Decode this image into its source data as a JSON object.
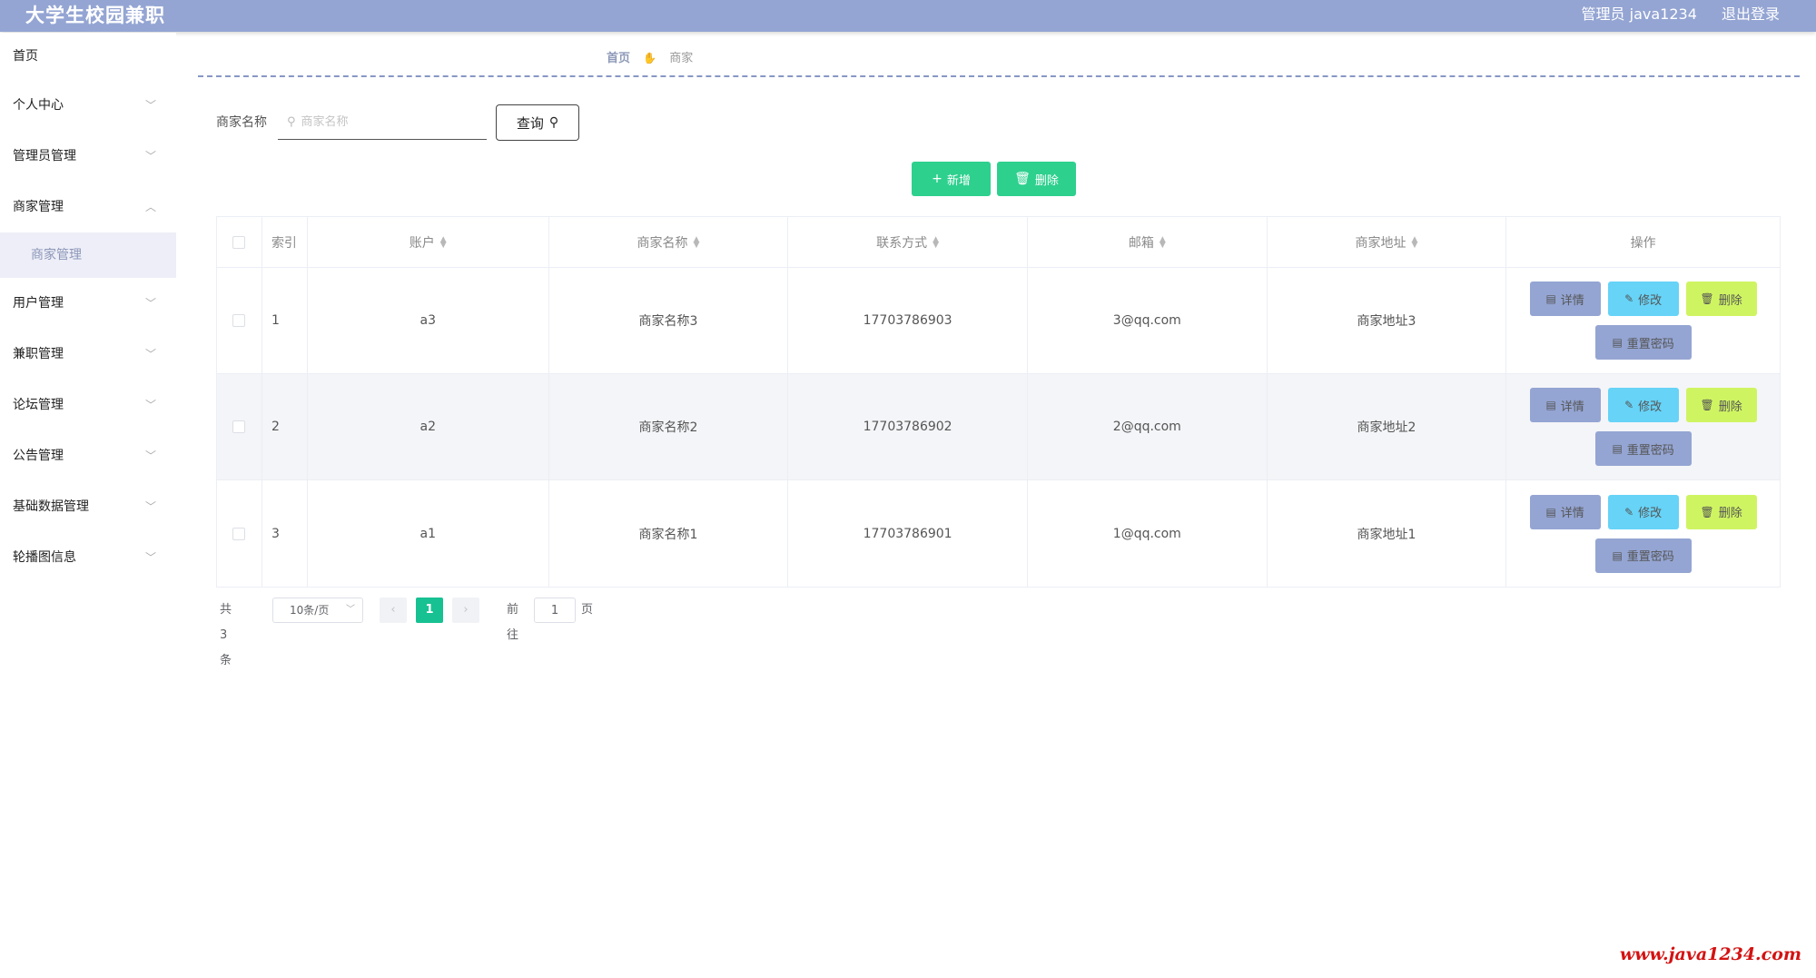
{
  "header": {
    "title": "大学生校园兼职",
    "user": "管理员 java1234",
    "logout": "退出登录"
  },
  "sidebar": {
    "items": [
      {
        "label": "首页"
      },
      {
        "label": "个人中心"
      },
      {
        "label": "管理员管理"
      },
      {
        "label": "商家管理",
        "children": [
          {
            "label": "商家管理"
          }
        ]
      },
      {
        "label": "用户管理"
      },
      {
        "label": "兼职管理"
      },
      {
        "label": "论坛管理"
      },
      {
        "label": "公告管理"
      },
      {
        "label": "基础数据管理"
      },
      {
        "label": "轮播图信息"
      }
    ]
  },
  "breadcrumb": {
    "home": "首页",
    "current": "商家"
  },
  "search": {
    "label": "商家名称",
    "placeholder": "商家名称",
    "value": "",
    "query_label": "查询"
  },
  "actions": {
    "add_label": "新增",
    "delete_label": "删除"
  },
  "table": {
    "headers": [
      "索引",
      "账户",
      "商家名称",
      "联系方式",
      "邮箱",
      "商家地址",
      "操作"
    ],
    "rows": [
      {
        "index": "1",
        "account": "a3",
        "name": "商家名称3",
        "phone": "17703786903",
        "email": "3@qq.com",
        "address": "商家地址3"
      },
      {
        "index": "2",
        "account": "a2",
        "name": "商家名称2",
        "phone": "17703786902",
        "email": "2@qq.com",
        "address": "商家地址2"
      },
      {
        "index": "3",
        "account": "a1",
        "name": "商家名称1",
        "phone": "17703786901",
        "email": "1@qq.com",
        "address": "商家地址1"
      }
    ],
    "row_actions": {
      "detail": "详情",
      "edit": "修改",
      "delete": "删除",
      "reset": "重置密码"
    }
  },
  "pagination": {
    "total": "共 3 条",
    "page_size": "10条/页",
    "current_page": "1",
    "goto_label": "前往",
    "goto_value": "1",
    "unit": "页"
  },
  "watermark": "www.java1234.com",
  "colors": {
    "header_bg": "#94a5d3",
    "primary_green": "#2ed08e",
    "detail_btn": "#94a5d3",
    "edit_btn": "#66d3f7",
    "delete_btn": "#cff462",
    "active_page": "#17c192"
  }
}
